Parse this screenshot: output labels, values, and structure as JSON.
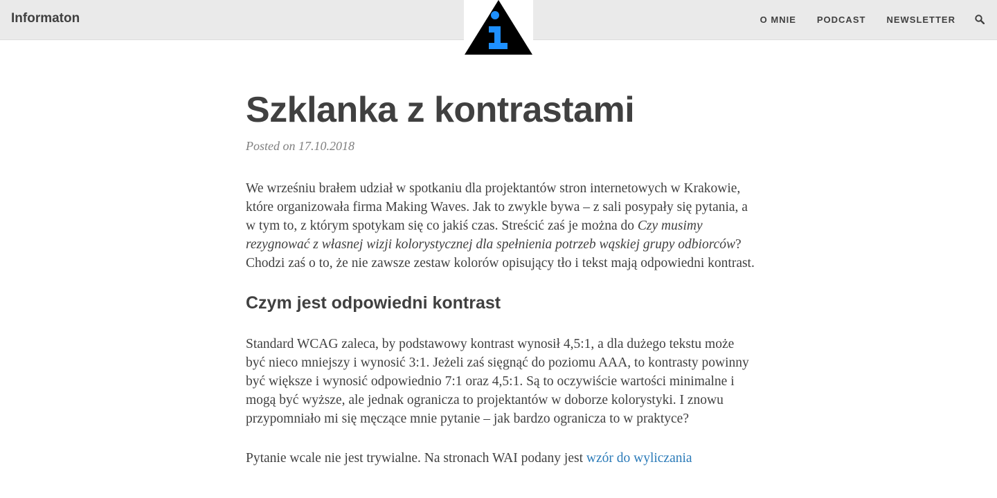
{
  "navbar": {
    "brand": "Informaton",
    "links": [
      "O MNIE",
      "PODCAST",
      "NEWSLETTER"
    ],
    "search_icon": "search-icon",
    "logo_icon": "info-triangle-icon"
  },
  "post": {
    "title": "Szklanka z kontrastami",
    "meta": "Posted on 17.10.2018",
    "p1_a": "We wrześniu brałem udział w spotkaniu dla projektantów stron internetowych w Krakowie, które organizowała firma Making Waves. Jak to zwykle bywa – z sali posypały się pytania, a w tym to, z którym spotykam się co jakiś czas. Streścić zaś je można do ",
    "p1_em": "Czy musimy rezygnować z własnej wizji kolorystycznej dla spełnienia potrzeb wąskiej grupy odbiorców",
    "p1_b": "? Chodzi zaś o to, że nie zawsze zestaw kolorów opisujący tło i tekst mają odpowiedni kontrast.",
    "h2": "Czym jest odpowiedni kontrast",
    "p2": "Standard WCAG zaleca, by podstawowy kontrast wynosił 4,5:1, a dla dużego tekstu może być nieco mniejszy i wynosić 3:1. Jeżeli zaś sięgnąć do poziomu AAA, to kontrasty powinny być większe i wynosić odpowiednio 7:1 oraz 4,5:1. Są to oczywiście wartości minimalne i mogą być wyższe, ale jednak ogranicza to projektantów w doborze kolorystyki. I znowu przypomniało mi się męczące mnie pytanie – jak bardzo ogranicza to w praktyce?",
    "p3_text": "Pytanie wcale nie jest trywialne. Na stronach WAI podany jest ",
    "p3_link": "wzór do wyliczania"
  },
  "colors": {
    "navbar_bg": "#eaeaea",
    "text": "#404040",
    "meta": "#808080",
    "link": "#2a7ab8",
    "logo_accent": "#1e90ff"
  }
}
